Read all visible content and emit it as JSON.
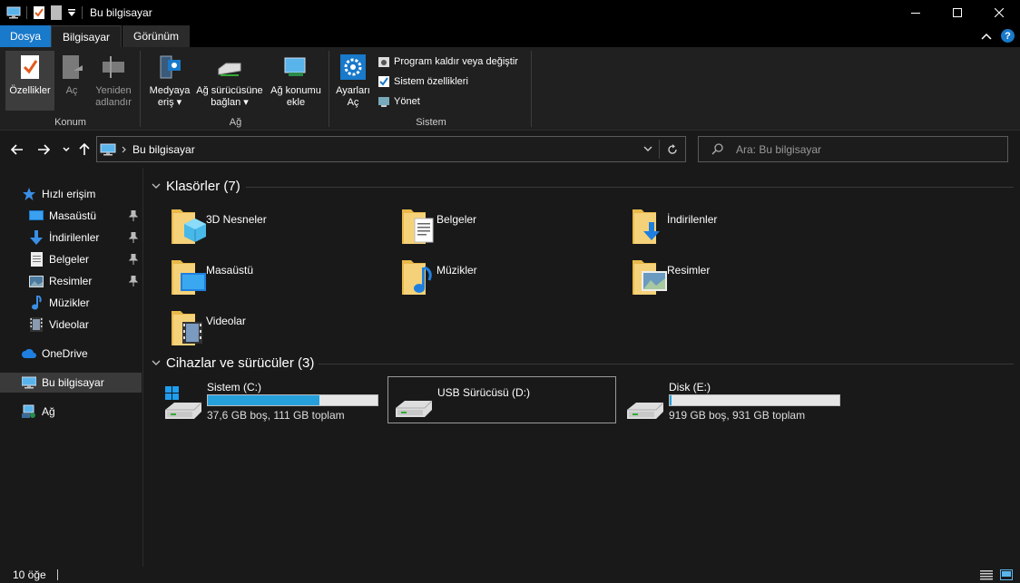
{
  "window": {
    "title": "Bu bilgisayar"
  },
  "ribbon_tabs": {
    "file": "Dosya",
    "computer": "Bilgisayar",
    "view": "Görünüm"
  },
  "ribbon": {
    "konum": {
      "name": "Konum",
      "properties": "Özellikler",
      "open": "Aç",
      "rename_1": "Yeniden",
      "rename_2": "adlandır"
    },
    "ag": {
      "name": "Ağ",
      "media_1": "Medyaya",
      "media_2": "eriş",
      "map_1": "Ağ sürücüsüne",
      "map_2": "bağlan",
      "addloc_1": "Ağ konumu",
      "addloc_2": "ekle"
    },
    "sistem": {
      "name": "Sistem",
      "settings_1": "Ayarları",
      "settings_2": "Aç",
      "uninstall": "Program kaldır veya değiştir",
      "sysprops": "Sistem özellikleri",
      "manage": "Yönet"
    }
  },
  "address": {
    "path": "Bu bilgisayar",
    "search_placeholder": "Ara: Bu bilgisayar"
  },
  "sidebar": {
    "quick_access": "Hızlı erişim",
    "items": [
      "Masaüstü",
      "İndirilenler",
      "Belgeler",
      "Resimler",
      "Müzikler",
      "Videolar"
    ],
    "onedrive": "OneDrive",
    "this_pc": "Bu bilgisayar",
    "network": "Ağ"
  },
  "folders": {
    "header": "Klasörler (7)",
    "items": [
      "3D Nesneler",
      "Belgeler",
      "İndirilenler",
      "Masaüstü",
      "Müzikler",
      "Resimler",
      "Videolar"
    ]
  },
  "drives": {
    "header": "Cihazlar ve sürücüler (3)",
    "items": [
      {
        "name": "Sistem (C:)",
        "info": "37,6 GB boş, 111 GB toplam",
        "used_fraction": 0.66
      },
      {
        "name": "USB Sürücüsü (D:)",
        "info": "",
        "used_fraction": 0
      },
      {
        "name": "Disk (E:)",
        "info": "919 GB boş, 931 GB toplam",
        "used_fraction": 0.013
      }
    ]
  },
  "status": {
    "count": "10 öğe"
  },
  "colors": {
    "accent": "#1979ca",
    "drive_bar": "#26a0da",
    "background": "#191919"
  }
}
